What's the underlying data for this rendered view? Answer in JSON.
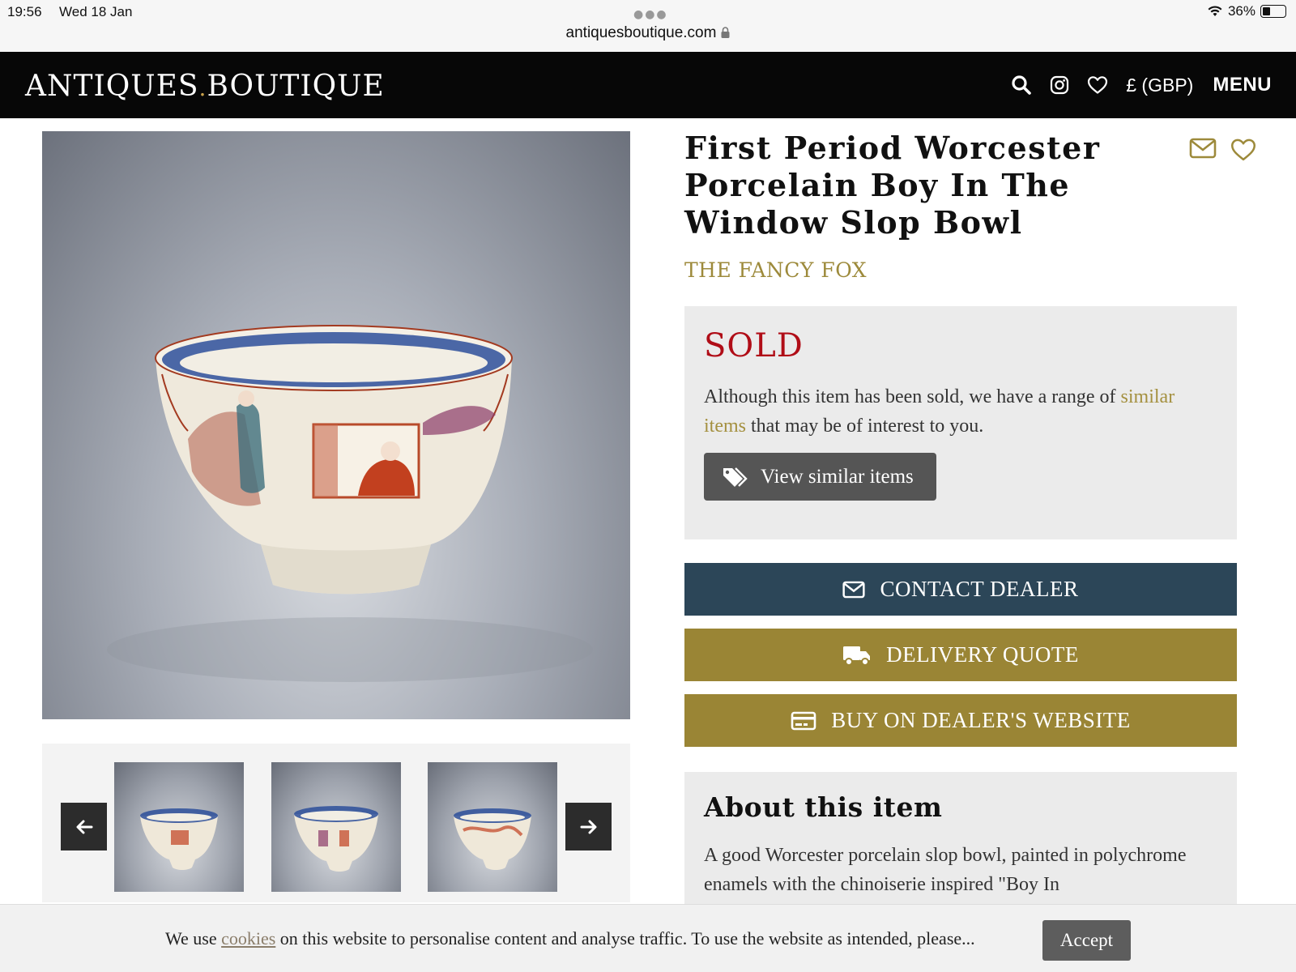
{
  "status_bar": {
    "time": "19:56",
    "date": "Wed 18 Jan",
    "battery": "36%",
    "battery_level": 0.36,
    "url": "antiquesboutique.com"
  },
  "header": {
    "logo_left": "ANTIQUES",
    "logo_dot": ".",
    "logo_right": "BOUTIQUE",
    "currency": "£ (GBP)",
    "menu_label": "MENU",
    "icons": [
      "search-icon",
      "instagram-icon",
      "heart-icon"
    ]
  },
  "product": {
    "title": "First Period Worcester Porcelain Boy In The Window Slop Bowl",
    "dealer": "THE FANCY FOX",
    "actions": [
      "envelope-icon",
      "heart-icon"
    ]
  },
  "sold_box": {
    "heading": "SOLD",
    "text_before": "Although this item has been sold, we have a range of ",
    "link_text": "similar items",
    "text_after": " that may be of interest to you.",
    "button_label": "View similar items"
  },
  "buttons": {
    "contact": "CONTACT DEALER",
    "delivery": "DELIVERY QUOTE",
    "buy": "BUY ON DEALER'S WEBSITE"
  },
  "about": {
    "heading": "About this item",
    "text": "A good Worcester porcelain slop bowl, painted in polychrome enamels with the chinoiserie inspired \"Boy In"
  },
  "cookie": {
    "text_before": "We use ",
    "link_text": "cookies",
    "text_after": " on this website to personalise content and analyse traffic. To use the website as intended, please...",
    "accept_label": "Accept"
  },
  "colors": {
    "header_bg": "#070707",
    "logo_dot": "#c8a14b",
    "dealer_gold": "#9d8a3b",
    "sold_red": "#b00d17",
    "contact_blue": "#2c4658",
    "gold_button": "#9a8535"
  }
}
